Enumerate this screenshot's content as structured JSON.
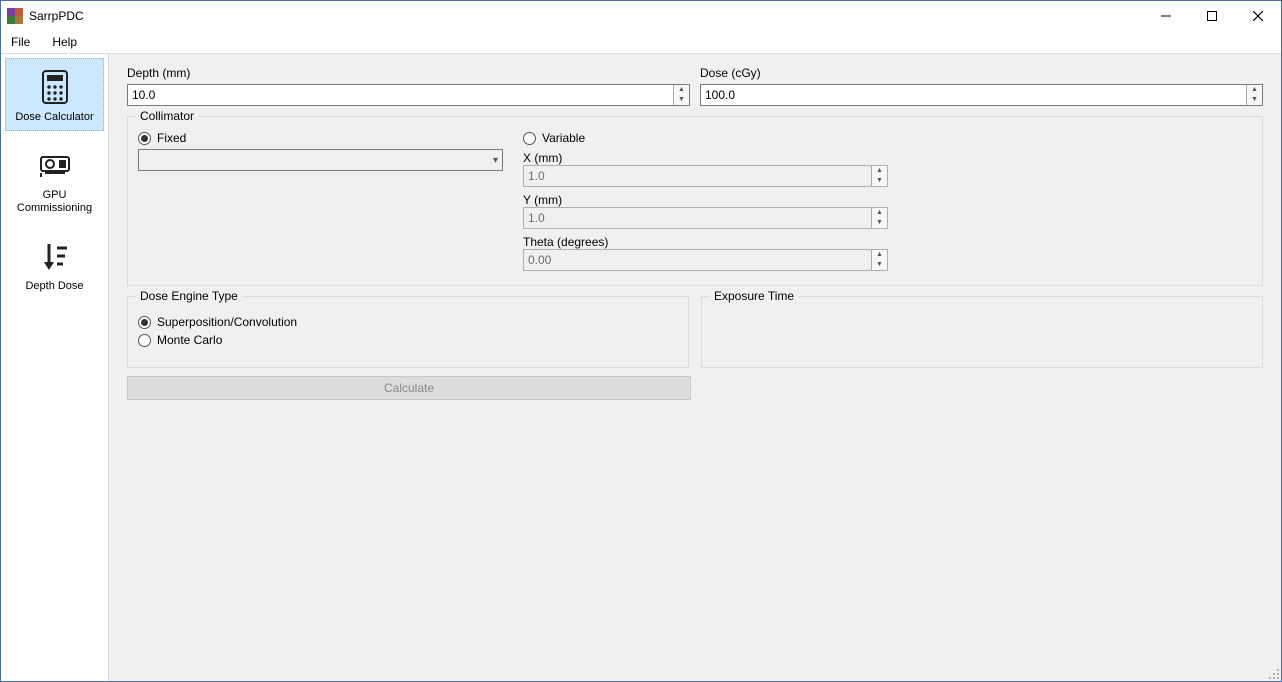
{
  "titlebar": {
    "title": "SarrpPDC"
  },
  "menu": {
    "file": "File",
    "help": "Help"
  },
  "sidebar": {
    "items": [
      {
        "label": "Dose Calculator"
      },
      {
        "label": "GPU Commissioning"
      },
      {
        "label": "Depth Dose"
      }
    ]
  },
  "form": {
    "depth_label": "Depth (mm)",
    "depth_value": "10.0",
    "dose_label": "Dose (cGy)",
    "dose_value": "100.0"
  },
  "collimator": {
    "legend": "Collimator",
    "fixed_label": "Fixed",
    "variable_label": "Variable",
    "x_label": "X (mm)",
    "x_value": "1.0",
    "y_label": "Y (mm)",
    "y_value": "1.0",
    "theta_label": "Theta (degrees)",
    "theta_value": "0.00"
  },
  "engine": {
    "legend": "Dose Engine Type",
    "superposition_label": "Superposition/Convolution",
    "monte_carlo_label": "Monte Carlo"
  },
  "exposure": {
    "legend": "Exposure Time"
  },
  "calculate_label": "Calculate"
}
